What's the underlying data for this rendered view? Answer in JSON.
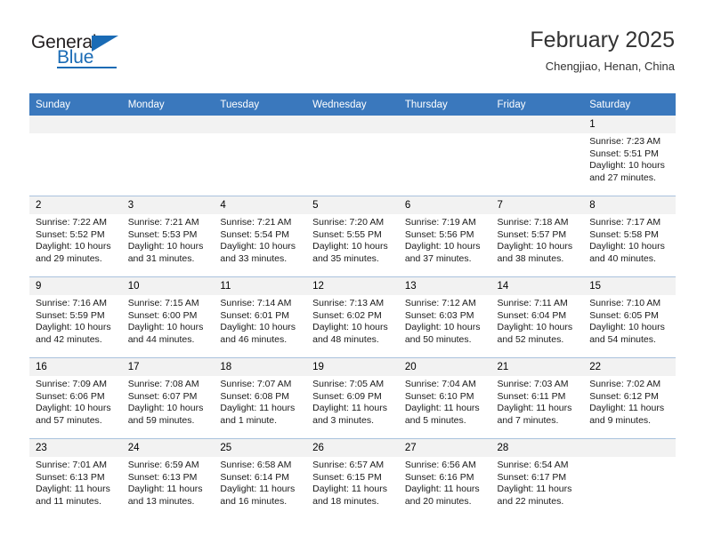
{
  "brand": {
    "name_part1": "General",
    "name_part2": "Blue",
    "accent_color": "#1a6bb5"
  },
  "header": {
    "title": "February 2025",
    "location": "Chengjiao, Henan, China"
  },
  "theme": {
    "header_bg": "#3a78bd",
    "daynum_bg": "#f2f2f2",
    "grid_line": "#a9c2dd"
  },
  "weekday_headers": [
    "Sunday",
    "Monday",
    "Tuesday",
    "Wednesday",
    "Thursday",
    "Friday",
    "Saturday"
  ],
  "weeks": [
    [
      {
        "day": "",
        "sunrise": "",
        "sunset": "",
        "daylight1": "",
        "daylight2": ""
      },
      {
        "day": "",
        "sunrise": "",
        "sunset": "",
        "daylight1": "",
        "daylight2": ""
      },
      {
        "day": "",
        "sunrise": "",
        "sunset": "",
        "daylight1": "",
        "daylight2": ""
      },
      {
        "day": "",
        "sunrise": "",
        "sunset": "",
        "daylight1": "",
        "daylight2": ""
      },
      {
        "day": "",
        "sunrise": "",
        "sunset": "",
        "daylight1": "",
        "daylight2": ""
      },
      {
        "day": "",
        "sunrise": "",
        "sunset": "",
        "daylight1": "",
        "daylight2": ""
      },
      {
        "day": "1",
        "sunrise": "Sunrise: 7:23 AM",
        "sunset": "Sunset: 5:51 PM",
        "daylight1": "Daylight: 10 hours",
        "daylight2": "and 27 minutes."
      }
    ],
    [
      {
        "day": "2",
        "sunrise": "Sunrise: 7:22 AM",
        "sunset": "Sunset: 5:52 PM",
        "daylight1": "Daylight: 10 hours",
        "daylight2": "and 29 minutes."
      },
      {
        "day": "3",
        "sunrise": "Sunrise: 7:21 AM",
        "sunset": "Sunset: 5:53 PM",
        "daylight1": "Daylight: 10 hours",
        "daylight2": "and 31 minutes."
      },
      {
        "day": "4",
        "sunrise": "Sunrise: 7:21 AM",
        "sunset": "Sunset: 5:54 PM",
        "daylight1": "Daylight: 10 hours",
        "daylight2": "and 33 minutes."
      },
      {
        "day": "5",
        "sunrise": "Sunrise: 7:20 AM",
        "sunset": "Sunset: 5:55 PM",
        "daylight1": "Daylight: 10 hours",
        "daylight2": "and 35 minutes."
      },
      {
        "day": "6",
        "sunrise": "Sunrise: 7:19 AM",
        "sunset": "Sunset: 5:56 PM",
        "daylight1": "Daylight: 10 hours",
        "daylight2": "and 37 minutes."
      },
      {
        "day": "7",
        "sunrise": "Sunrise: 7:18 AM",
        "sunset": "Sunset: 5:57 PM",
        "daylight1": "Daylight: 10 hours",
        "daylight2": "and 38 minutes."
      },
      {
        "day": "8",
        "sunrise": "Sunrise: 7:17 AM",
        "sunset": "Sunset: 5:58 PM",
        "daylight1": "Daylight: 10 hours",
        "daylight2": "and 40 minutes."
      }
    ],
    [
      {
        "day": "9",
        "sunrise": "Sunrise: 7:16 AM",
        "sunset": "Sunset: 5:59 PM",
        "daylight1": "Daylight: 10 hours",
        "daylight2": "and 42 minutes."
      },
      {
        "day": "10",
        "sunrise": "Sunrise: 7:15 AM",
        "sunset": "Sunset: 6:00 PM",
        "daylight1": "Daylight: 10 hours",
        "daylight2": "and 44 minutes."
      },
      {
        "day": "11",
        "sunrise": "Sunrise: 7:14 AM",
        "sunset": "Sunset: 6:01 PM",
        "daylight1": "Daylight: 10 hours",
        "daylight2": "and 46 minutes."
      },
      {
        "day": "12",
        "sunrise": "Sunrise: 7:13 AM",
        "sunset": "Sunset: 6:02 PM",
        "daylight1": "Daylight: 10 hours",
        "daylight2": "and 48 minutes."
      },
      {
        "day": "13",
        "sunrise": "Sunrise: 7:12 AM",
        "sunset": "Sunset: 6:03 PM",
        "daylight1": "Daylight: 10 hours",
        "daylight2": "and 50 minutes."
      },
      {
        "day": "14",
        "sunrise": "Sunrise: 7:11 AM",
        "sunset": "Sunset: 6:04 PM",
        "daylight1": "Daylight: 10 hours",
        "daylight2": "and 52 minutes."
      },
      {
        "day": "15",
        "sunrise": "Sunrise: 7:10 AM",
        "sunset": "Sunset: 6:05 PM",
        "daylight1": "Daylight: 10 hours",
        "daylight2": "and 54 minutes."
      }
    ],
    [
      {
        "day": "16",
        "sunrise": "Sunrise: 7:09 AM",
        "sunset": "Sunset: 6:06 PM",
        "daylight1": "Daylight: 10 hours",
        "daylight2": "and 57 minutes."
      },
      {
        "day": "17",
        "sunrise": "Sunrise: 7:08 AM",
        "sunset": "Sunset: 6:07 PM",
        "daylight1": "Daylight: 10 hours",
        "daylight2": "and 59 minutes."
      },
      {
        "day": "18",
        "sunrise": "Sunrise: 7:07 AM",
        "sunset": "Sunset: 6:08 PM",
        "daylight1": "Daylight: 11 hours",
        "daylight2": "and 1 minute."
      },
      {
        "day": "19",
        "sunrise": "Sunrise: 7:05 AM",
        "sunset": "Sunset: 6:09 PM",
        "daylight1": "Daylight: 11 hours",
        "daylight2": "and 3 minutes."
      },
      {
        "day": "20",
        "sunrise": "Sunrise: 7:04 AM",
        "sunset": "Sunset: 6:10 PM",
        "daylight1": "Daylight: 11 hours",
        "daylight2": "and 5 minutes."
      },
      {
        "day": "21",
        "sunrise": "Sunrise: 7:03 AM",
        "sunset": "Sunset: 6:11 PM",
        "daylight1": "Daylight: 11 hours",
        "daylight2": "and 7 minutes."
      },
      {
        "day": "22",
        "sunrise": "Sunrise: 7:02 AM",
        "sunset": "Sunset: 6:12 PM",
        "daylight1": "Daylight: 11 hours",
        "daylight2": "and 9 minutes."
      }
    ],
    [
      {
        "day": "23",
        "sunrise": "Sunrise: 7:01 AM",
        "sunset": "Sunset: 6:13 PM",
        "daylight1": "Daylight: 11 hours",
        "daylight2": "and 11 minutes."
      },
      {
        "day": "24",
        "sunrise": "Sunrise: 6:59 AM",
        "sunset": "Sunset: 6:13 PM",
        "daylight1": "Daylight: 11 hours",
        "daylight2": "and 13 minutes."
      },
      {
        "day": "25",
        "sunrise": "Sunrise: 6:58 AM",
        "sunset": "Sunset: 6:14 PM",
        "daylight1": "Daylight: 11 hours",
        "daylight2": "and 16 minutes."
      },
      {
        "day": "26",
        "sunrise": "Sunrise: 6:57 AM",
        "sunset": "Sunset: 6:15 PM",
        "daylight1": "Daylight: 11 hours",
        "daylight2": "and 18 minutes."
      },
      {
        "day": "27",
        "sunrise": "Sunrise: 6:56 AM",
        "sunset": "Sunset: 6:16 PM",
        "daylight1": "Daylight: 11 hours",
        "daylight2": "and 20 minutes."
      },
      {
        "day": "28",
        "sunrise": "Sunrise: 6:54 AM",
        "sunset": "Sunset: 6:17 PM",
        "daylight1": "Daylight: 11 hours",
        "daylight2": "and 22 minutes."
      },
      {
        "day": "",
        "sunrise": "",
        "sunset": "",
        "daylight1": "",
        "daylight2": ""
      }
    ]
  ]
}
